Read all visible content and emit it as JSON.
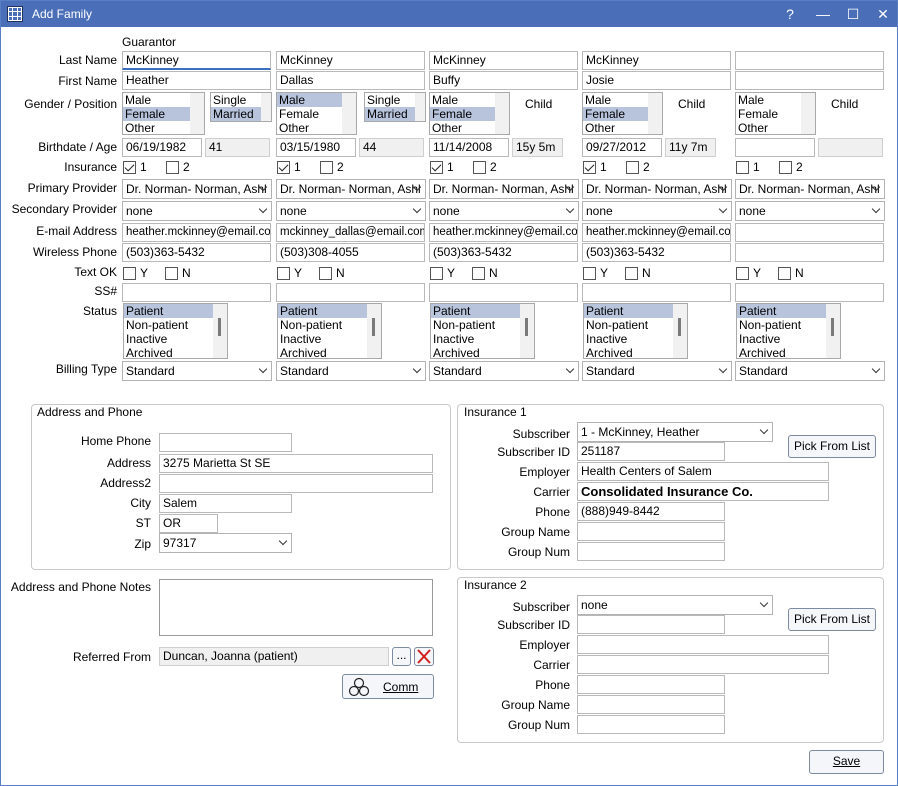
{
  "window": {
    "title": "Add Family",
    "help": "?",
    "minimize": "—",
    "maximize": "☐",
    "close": "✕"
  },
  "labels": {
    "guarantor": "Guarantor",
    "last_name": "Last Name",
    "first_name": "First Name",
    "gender_position": "Gender / Position",
    "birthdate_age": "Birthdate / Age",
    "insurance": "Insurance",
    "primary_provider": "Primary Provider",
    "secondary_provider": "Secondary Provider",
    "email": "E-mail Address",
    "wireless_phone": "Wireless Phone",
    "text_ok": "Text OK",
    "ssn": "SS#",
    "status": "Status",
    "billing_type": "Billing Type"
  },
  "gender_options": [
    "Male",
    "Female",
    "Other"
  ],
  "position_options": [
    "Single",
    "Married"
  ],
  "status_options": [
    "Patient",
    "Non-patient",
    "Inactive",
    "Archived"
  ],
  "ins_labels": [
    "1",
    "2"
  ],
  "yn_labels": [
    "Y",
    "N"
  ],
  "members": [
    {
      "last": "McKinney",
      "first": "Heather",
      "gender": "Female",
      "position": "Married",
      "birthdate": "06/19/1982",
      "age": "41",
      "ins1": true,
      "ins2": false,
      "primary": "Dr. Norman- Norman, Ashl",
      "secondary": "none",
      "email": "heather.mckinney@email.com",
      "phone": "(503)363-5432",
      "ssn": "",
      "status": "Patient",
      "billing": "Standard"
    },
    {
      "last": "McKinney",
      "first": "Dallas",
      "gender": "Male",
      "position": "Married",
      "birthdate": "03/15/1980",
      "age": "44",
      "ins1": true,
      "ins2": false,
      "primary": "Dr. Norman- Norman, Ashl",
      "secondary": "none",
      "email": "mckinney_dallas@email.com",
      "phone": "(503)308-4055",
      "ssn": "",
      "status": "Patient",
      "billing": "Standard"
    },
    {
      "last": "McKinney",
      "first": "Buffy",
      "gender": "Female",
      "position": "Child",
      "birthdate": "11/14/2008",
      "age": "15y 5m",
      "ins1": true,
      "ins2": false,
      "primary": "Dr. Norman- Norman, Ashl",
      "secondary": "none",
      "email": "heather.mckinney@email.com",
      "phone": "(503)363-5432",
      "ssn": "",
      "status": "Patient",
      "billing": "Standard"
    },
    {
      "last": "McKinney",
      "first": "Josie",
      "gender": "Female",
      "position": "Child",
      "birthdate": "09/27/2012",
      "age": "11y 7m",
      "ins1": true,
      "ins2": false,
      "primary": "Dr. Norman- Norman, Ashl",
      "secondary": "none",
      "email": "heather.mckinney@email.com",
      "phone": "(503)363-5432",
      "ssn": "",
      "status": "Patient",
      "billing": "Standard"
    },
    {
      "last": "",
      "first": "",
      "gender": "",
      "position": "Child",
      "birthdate": "",
      "age": "",
      "ins1": false,
      "ins2": false,
      "primary": "Dr. Norman- Norman, Ashl",
      "secondary": "none",
      "email": "",
      "phone": "",
      "ssn": "",
      "status": "Patient",
      "billing": "Standard"
    }
  ],
  "address": {
    "group_title": "Address and Phone",
    "home_phone_label": "Home Phone",
    "home_phone": "",
    "address_label": "Address",
    "address": "3275 Marietta St SE",
    "address2_label": "Address2",
    "address2": "",
    "city_label": "City",
    "city": "Salem",
    "st_label": "ST",
    "st": "OR",
    "zip_label": "Zip",
    "zip": "97317"
  },
  "notes": {
    "label": "Address and Phone Notes",
    "value": ""
  },
  "referred": {
    "label": "Referred From",
    "value": "Duncan, Joanna (patient)",
    "browse": "..."
  },
  "comm_button": "Comm",
  "insurance1": {
    "group_title": "Insurance 1",
    "subscriber_label": "Subscriber",
    "subscriber": "1 - McKinney, Heather",
    "subscriber_id_label": "Subscriber ID",
    "subscriber_id": "251187",
    "pick_button": "Pick From List",
    "employer_label": "Employer",
    "employer": "Health Centers of Salem",
    "carrier_label": "Carrier",
    "carrier": "Consolidated Insurance Co.",
    "phone_label": "Phone",
    "phone": "(888)949-8442",
    "group_name_label": "Group Name",
    "group_name": "",
    "group_num_label": "Group Num",
    "group_num": ""
  },
  "insurance2": {
    "group_title": "Insurance 2",
    "subscriber_label": "Subscriber",
    "subscriber": "none",
    "subscriber_id_label": "Subscriber ID",
    "subscriber_id": "",
    "pick_button": "Pick From List",
    "employer_label": "Employer",
    "employer": "",
    "carrier_label": "Carrier",
    "carrier": "",
    "phone_label": "Phone",
    "phone": "",
    "group_name_label": "Group Name",
    "group_name": "",
    "group_num_label": "Group Num",
    "group_num": ""
  },
  "save_button": "Save",
  "colors": {
    "titlebar": "#4a6fb8",
    "selection": "#b7c4dc",
    "delete_red": "#d21f1f"
  }
}
